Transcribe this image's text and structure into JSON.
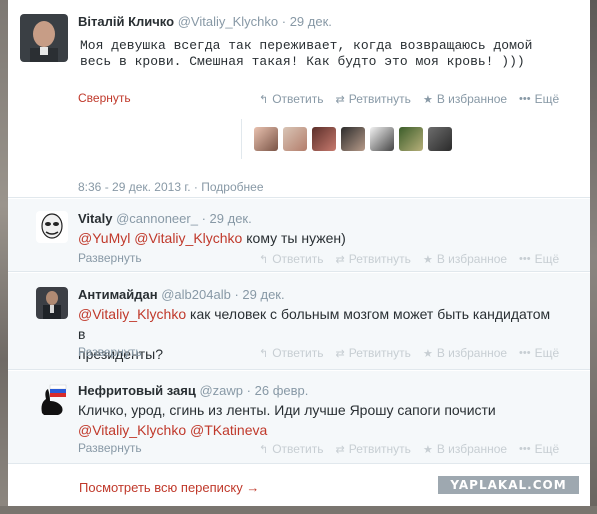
{
  "main_tweet": {
    "author_name": "Віталій Кличко",
    "author_handle": "@Vitaliy_Klychko",
    "date": "29 дек.",
    "text_line1": "Моя девушка всегда так переживает, когда возвращаюсь домой",
    "text_line2": "весь в крови. Смешная такая! Как будто это моя кровь! )))",
    "collapse_label": "Свернуть",
    "timestamp": "8:36 - 29 дек. 2013 г.",
    "details_label": "Подробнее"
  },
  "actions": {
    "reply": "Ответить",
    "retweet": "Ретвитнуть",
    "favorite": "В избранное",
    "more": "Ещё"
  },
  "replies": [
    {
      "author_name": "Vitaly",
      "author_handle": "@cannoneer_",
      "date": "29 дек.",
      "mention1": "@YuMyl",
      "mention2": "@Vitaliy_Klychko",
      "text": " кому ты нужен)",
      "expand_label": "Развернуть"
    },
    {
      "author_name": "Антимайдан",
      "author_handle": "@alb204alb",
      "date": "29 дек.",
      "mention1": "@Vitaliy_Klychko",
      "text": " как человек с больным мозгом может быть кандидатом в",
      "text_line2": "президенты?",
      "expand_label": "Развернуть"
    },
    {
      "author_name": "Нефритовый заяц",
      "author_handle": "@zawp",
      "date": "26 февр.",
      "text": "Кличко, урод, сгинь из ленты. Иди лучше Ярошу сапоги почисти",
      "mention1": "@Vitaliy_Klychko",
      "mention2": "@TKatineva",
      "expand_label": "Развернуть"
    }
  ],
  "footer": {
    "view_conversation": "Посмотреть всю переписку →",
    "watermark": "YAPLAKAL.COM"
  },
  "colors": {
    "accent": "#c0392b",
    "muted": "#8899a6",
    "reply_bg": "#f5f8fa"
  }
}
